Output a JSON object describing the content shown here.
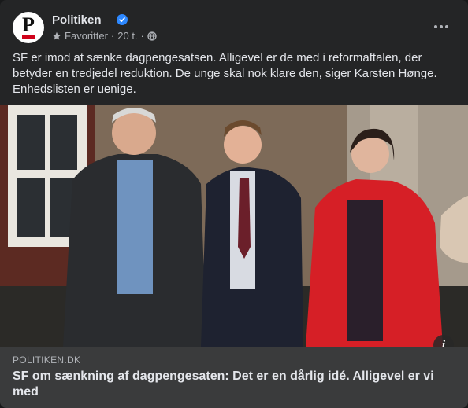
{
  "post": {
    "page_name": "Politiken",
    "meta": {
      "favorites": "Favoritter",
      "separator": "·",
      "time": "20 t.",
      "separator2": "·"
    },
    "text": "SF er imod at sænke dagpengesatsen. Alligevel er de med i reformaftalen, der betyder en tredjedel reduktion. De unge skal nok klare den, siger Karsten Hønge. Enhedslisten er uenige.",
    "link": {
      "domain": "POLITIKEN.DK",
      "headline": "SF om sænkning af dagpengesaten: Det er en dårlig idé. Alligevel er vi med"
    },
    "avatar_letter": "P"
  },
  "colors": {
    "card_bg": "#242526",
    "link_bar_bg": "#3a3b3c",
    "verified_blue": "#2d88ff",
    "brand_red": "#d0021b"
  },
  "icons": [
    "verified-badge-icon",
    "star-icon",
    "globe-icon",
    "more-options-icon",
    "info-icon"
  ]
}
